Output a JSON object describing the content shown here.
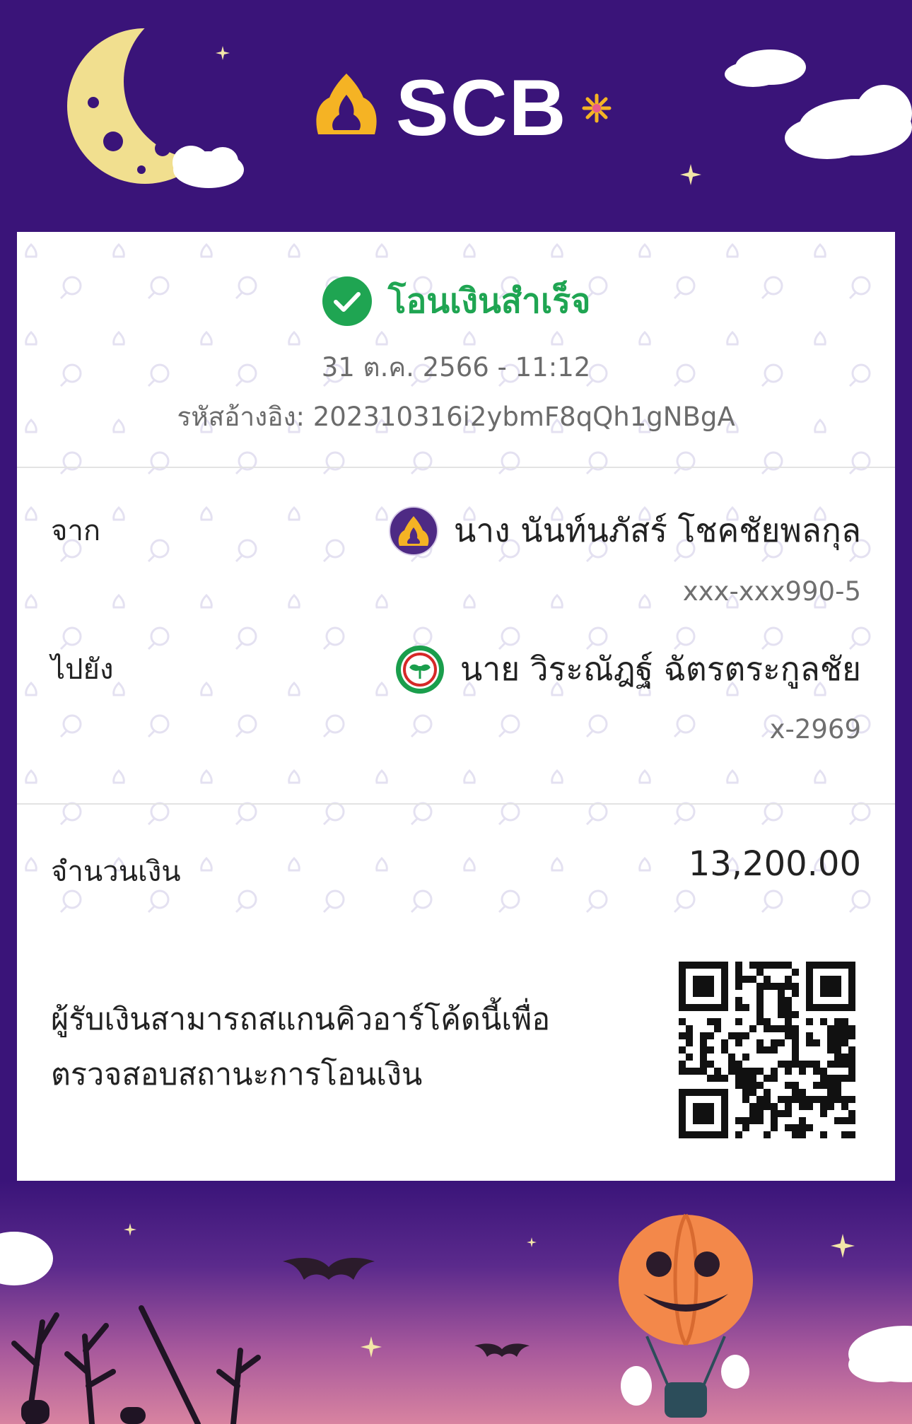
{
  "header": {
    "brand": "SCB",
    "brand_color": "#3a1479",
    "logo_color": "#f5b324"
  },
  "status": {
    "title": "โอนเงินสำเร็จ",
    "color": "#1fa552",
    "datetime": "31 ต.ค. 2566 - 11:12",
    "reference_label": "รหัสอ้างอิง:",
    "reference_value": "202310316i2ybmF8qQh1gNBgA"
  },
  "from": {
    "label": "จาก",
    "name": "นาง นันท์นภัสร์ โชคชัยพลกุล",
    "account": "xxx-xxx990-5",
    "bank_icon": "scb-bank-icon"
  },
  "to": {
    "label": "ไปยัง",
    "name": "นาย วิระณัฎฐ์ ฉัตรตระกูลชัย",
    "account": "x-2969",
    "bank_icon": "kbank-bank-icon"
  },
  "amount": {
    "label": "จำนวนเงิน",
    "value": "13,200.00"
  },
  "qr": {
    "note_line1": "ผู้รับเงินสามารถสแกนคิวอาร์โค้ดนี้เพื่อ",
    "note_line2": "ตรวจสอบสถานะการโอนเงิน",
    "icon": "qr-code"
  }
}
